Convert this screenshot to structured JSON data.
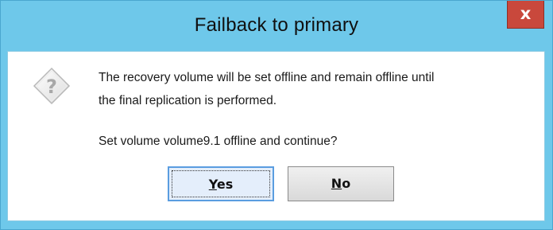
{
  "dialog": {
    "title": "Failback to primary",
    "close_glyph": "x",
    "icon": "question-icon",
    "message_line1": "The recovery volume will be set offline and remain offline until",
    "message_line2": "the final replication is performed.",
    "message_line3": "Set volume volume9.1 offline and continue?",
    "buttons": {
      "yes_mnemonic": "Y",
      "yes_rest": "es",
      "no_mnemonic": "N",
      "no_rest": "o"
    }
  },
  "colors": {
    "titlebar": "#6ec8ea",
    "close_button": "#c9483c",
    "default_button_border": "#5a9de0"
  }
}
